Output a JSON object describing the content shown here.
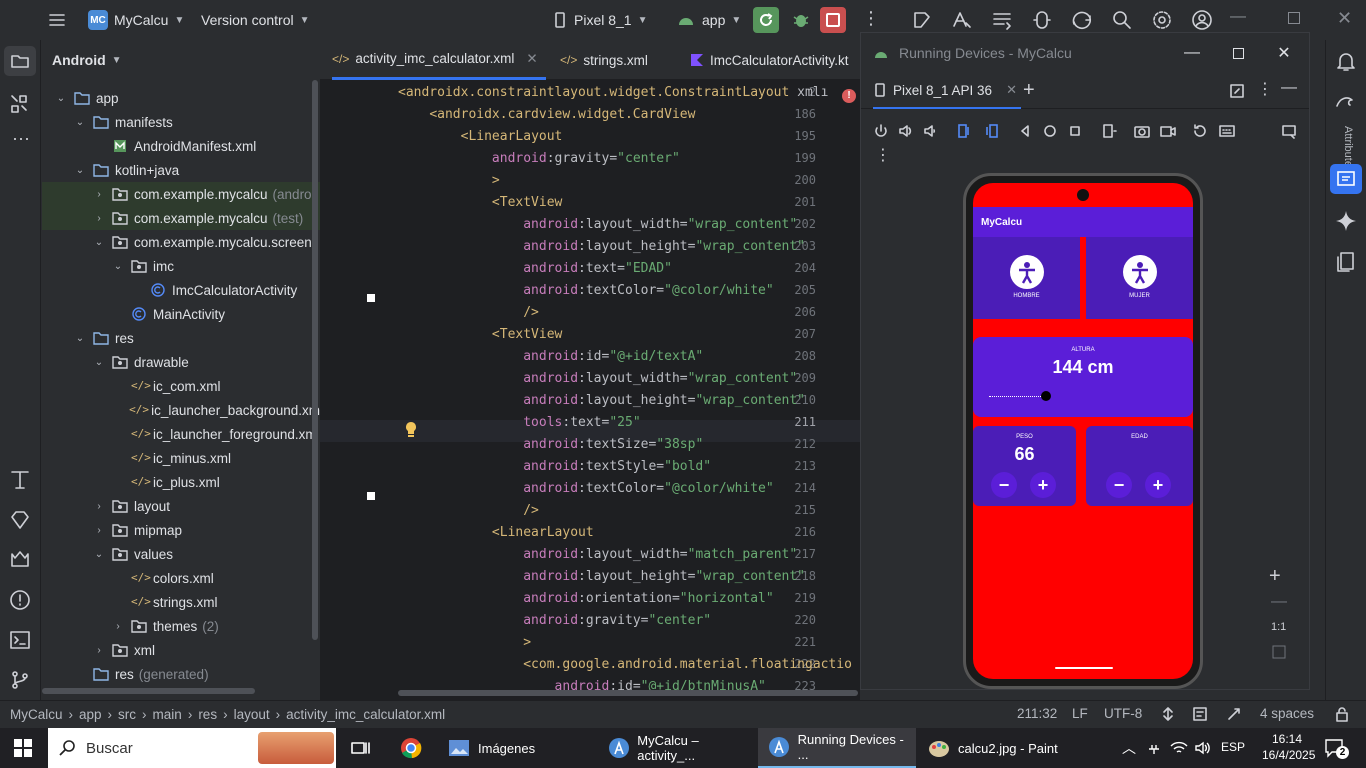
{
  "titlebar": {
    "project": "MyCalcu",
    "project_badge": "MC",
    "vcs": "Version control",
    "device": "Pixel 8_1",
    "run_config": "app"
  },
  "sidebar": {
    "title": "Android"
  },
  "tree": [
    {
      "label": "app",
      "indent": 0,
      "arrow": "▾",
      "icon": "folder"
    },
    {
      "label": "manifests",
      "indent": 1,
      "arrow": "▾",
      "icon": "folder"
    },
    {
      "label": "AndroidManifest.xml",
      "indent": 2,
      "arrow": "",
      "icon": "manifest"
    },
    {
      "label": "kotlin+java",
      "indent": 1,
      "arrow": "▾",
      "icon": "folder"
    },
    {
      "label": "com.example.mycalcu",
      "extra": "(androi",
      "indent": 2,
      "arrow": "›",
      "icon": "package",
      "sel": true
    },
    {
      "label": "com.example.mycalcu",
      "extra": "(test)",
      "indent": 2,
      "arrow": "›",
      "icon": "package",
      "sel": true
    },
    {
      "label": "com.example.mycalcu.screen",
      "indent": 2,
      "arrow": "▾",
      "icon": "package"
    },
    {
      "label": "imc",
      "indent": 3,
      "arrow": "▾",
      "icon": "package"
    },
    {
      "label": "ImcCalculatorActivity",
      "indent": 4,
      "arrow": "",
      "icon": "class"
    },
    {
      "label": "MainActivity",
      "indent": 3,
      "arrow": "",
      "icon": "class"
    },
    {
      "label": "res",
      "indent": 1,
      "arrow": "▾",
      "icon": "folder"
    },
    {
      "label": "drawable",
      "indent": 2,
      "arrow": "▾",
      "icon": "package"
    },
    {
      "label": "ic_com.xml",
      "indent": 3,
      "arrow": "",
      "icon": "xml"
    },
    {
      "label": "ic_launcher_background.xm",
      "indent": 3,
      "arrow": "",
      "icon": "xml"
    },
    {
      "label": "ic_launcher_foreground.xm",
      "indent": 3,
      "arrow": "",
      "icon": "xml"
    },
    {
      "label": "ic_minus.xml",
      "indent": 3,
      "arrow": "",
      "icon": "xml"
    },
    {
      "label": "ic_plus.xml",
      "indent": 3,
      "arrow": "",
      "icon": "xml"
    },
    {
      "label": "layout",
      "indent": 2,
      "arrow": "›",
      "icon": "package"
    },
    {
      "label": "mipmap",
      "indent": 2,
      "arrow": "›",
      "icon": "package"
    },
    {
      "label": "values",
      "indent": 2,
      "arrow": "▾",
      "icon": "package"
    },
    {
      "label": "colors.xml",
      "indent": 3,
      "arrow": "",
      "icon": "xml"
    },
    {
      "label": "strings.xml",
      "indent": 3,
      "arrow": "",
      "icon": "xml"
    },
    {
      "label": "themes",
      "extra": "(2)",
      "indent": 3,
      "arrow": "›",
      "icon": "package"
    },
    {
      "label": "xml",
      "indent": 2,
      "arrow": "›",
      "icon": "package"
    },
    {
      "label": "res",
      "extra": "(generated)",
      "indent": 1,
      "arrow": "",
      "icon": "folder"
    }
  ],
  "editor_tabs": [
    {
      "label": "activity_imc_calculator.xml",
      "active": true
    },
    {
      "label": "strings.xml"
    },
    {
      "label": "ImcCalculatorActivity.kt"
    }
  ],
  "code": [
    {
      "n": "2",
      "i": 0,
      "parts": [
        [
          "tg",
          "<androidx.constraintlayout.widget.ConstraintLayout "
        ],
        [
          "at",
          "xmlı"
        ]
      ]
    },
    {
      "n": "186",
      "i": 1,
      "parts": [
        [
          "tg",
          "<androidx.cardview.widget.CardView"
        ]
      ]
    },
    {
      "n": "195",
      "i": 2,
      "parts": [
        [
          "tg",
          "<LinearLayout"
        ]
      ]
    },
    {
      "n": "199",
      "i": 3,
      "parts": [
        [
          "an",
          "android"
        ],
        [
          "at",
          ":gravity="
        ],
        [
          "av",
          "\"center\""
        ]
      ]
    },
    {
      "n": "200",
      "i": 3,
      "parts": [
        [
          "tg",
          ">"
        ]
      ]
    },
    {
      "n": "201",
      "i": 3,
      "parts": [
        [
          "tg",
          "<TextView"
        ]
      ]
    },
    {
      "n": "202",
      "i": 4,
      "parts": [
        [
          "an",
          "android"
        ],
        [
          "at",
          ":layout_width="
        ],
        [
          "av",
          "\"wrap_content\""
        ]
      ]
    },
    {
      "n": "203",
      "i": 4,
      "parts": [
        [
          "an",
          "android"
        ],
        [
          "at",
          ":layout_height="
        ],
        [
          "av",
          "\"wrap_content\""
        ]
      ]
    },
    {
      "n": "204",
      "i": 4,
      "parts": [
        [
          "an",
          "android"
        ],
        [
          "at",
          ":text="
        ],
        [
          "av",
          "\"EDAD\""
        ]
      ]
    },
    {
      "n": "205",
      "i": 4,
      "parts": [
        [
          "an",
          "android"
        ],
        [
          "at",
          ":textColor="
        ],
        [
          "av",
          "\"@color/white\""
        ]
      ]
    },
    {
      "n": "206",
      "i": 4,
      "parts": [
        [
          "tg",
          "/>"
        ]
      ]
    },
    {
      "n": "207",
      "i": 3,
      "parts": [
        [
          "tg",
          "<TextView"
        ]
      ]
    },
    {
      "n": "208",
      "i": 4,
      "parts": [
        [
          "an",
          "android"
        ],
        [
          "at",
          ":id="
        ],
        [
          "av",
          "\"@+id/textA\""
        ]
      ]
    },
    {
      "n": "209",
      "i": 4,
      "parts": [
        [
          "an",
          "android"
        ],
        [
          "at",
          ":layout_width="
        ],
        [
          "av",
          "\"wrap_content\""
        ]
      ]
    },
    {
      "n": "210",
      "i": 4,
      "parts": [
        [
          "an",
          "android"
        ],
        [
          "at",
          ":layout_height="
        ],
        [
          "av",
          "\"wrap_content\""
        ]
      ]
    },
    {
      "n": "211",
      "i": 4,
      "parts": [
        [
          "an",
          "tools"
        ],
        [
          "at",
          ":text="
        ],
        [
          "av",
          "\"25\""
        ]
      ]
    },
    {
      "n": "212",
      "i": 4,
      "parts": [
        [
          "an",
          "android"
        ],
        [
          "at",
          ":textSize="
        ],
        [
          "av",
          "\"38sp\""
        ]
      ]
    },
    {
      "n": "213",
      "i": 4,
      "parts": [
        [
          "an",
          "android"
        ],
        [
          "at",
          ":textStyle="
        ],
        [
          "av",
          "\"bold\""
        ]
      ]
    },
    {
      "n": "214",
      "i": 4,
      "parts": [
        [
          "an",
          "android"
        ],
        [
          "at",
          ":textColor="
        ],
        [
          "av",
          "\"@color/white\""
        ]
      ]
    },
    {
      "n": "215",
      "i": 4,
      "parts": [
        [
          "tg",
          "/>"
        ]
      ]
    },
    {
      "n": "216",
      "i": 3,
      "parts": [
        [
          "tg",
          "<LinearLayout"
        ]
      ]
    },
    {
      "n": "217",
      "i": 4,
      "parts": [
        [
          "an",
          "android"
        ],
        [
          "at",
          ":layout_width="
        ],
        [
          "av",
          "\"match_parent\""
        ]
      ]
    },
    {
      "n": "218",
      "i": 4,
      "parts": [
        [
          "an",
          "android"
        ],
        [
          "at",
          ":layout_height="
        ],
        [
          "av",
          "\"wrap_content\""
        ]
      ]
    },
    {
      "n": "219",
      "i": 4,
      "parts": [
        [
          "an",
          "android"
        ],
        [
          "at",
          ":orientation="
        ],
        [
          "av",
          "\"horizontal\""
        ]
      ]
    },
    {
      "n": "220",
      "i": 4,
      "parts": [
        [
          "an",
          "android"
        ],
        [
          "at",
          ":gravity="
        ],
        [
          "av",
          "\"center\""
        ]
      ]
    },
    {
      "n": "221",
      "i": 4,
      "parts": [
        [
          "tg",
          ">"
        ]
      ]
    },
    {
      "n": "222",
      "i": 4,
      "parts": [
        [
          "tg",
          "<com.google.android.material.floatingactio"
        ]
      ]
    },
    {
      "n": "223",
      "i": 5,
      "parts": [
        [
          "an",
          "android"
        ],
        [
          "at",
          ":id="
        ],
        [
          "av",
          "\"@+id/btnMinusA\""
        ]
      ]
    }
  ],
  "running": {
    "title": "Running Devices - MyCalcu",
    "tab": "Pixel 8_1 API 36",
    "attributes_label": "Attributes",
    "zoom": "1:1"
  },
  "app": {
    "title": "MyCalcu",
    "hombre": "HOMBRE",
    "mujer": "MUJER",
    "altura_label": "ALTURA",
    "altura_value": "144 cm",
    "peso_label": "PESO",
    "peso_value": "66",
    "edad_label": "EDAD",
    "minus": "−",
    "plus": "+"
  },
  "statusbar": {
    "breadcrumb": [
      "MyCalcu",
      "app",
      "src",
      "main",
      "res",
      "layout",
      "activity_imc_calculator.xml"
    ],
    "position": "211:32",
    "line_sep": "LF",
    "encoding": "UTF-8",
    "indent": "4 spaces"
  },
  "taskbar": {
    "search": "Buscar",
    "tasks": [
      "Imágenes",
      "MyCalcu – activity_...",
      "Running Devices - ...",
      "calcu2.jpg - Paint"
    ],
    "lang": "ESP",
    "time": "16:14",
    "date": "16/4/2025",
    "notif": "2"
  },
  "colors": {
    "accent": "#3574f0",
    "phone_bg": "#ff0000",
    "purple": "#5b1ed8",
    "purple_dark": "#4b1db7"
  }
}
